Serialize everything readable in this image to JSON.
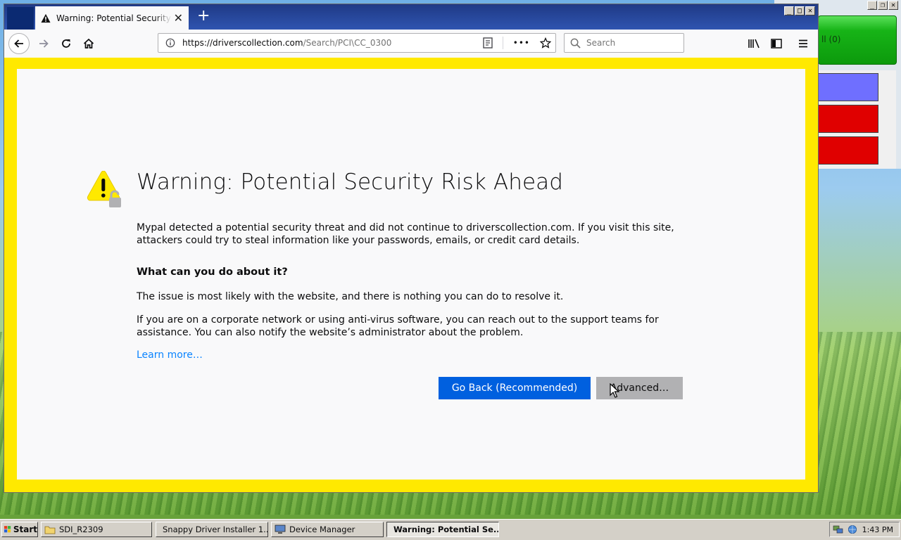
{
  "browser": {
    "tab_title": "Warning: Potential Security Risk Ahead",
    "new_tab_label": "+",
    "url_domain": "https://driverscollection.com",
    "url_path": "/Search/PCI\\CC_0300",
    "more_label": "•••",
    "search_placeholder": "Search",
    "minimize_label": "_",
    "maximize_label": "□",
    "close_label": "✕"
  },
  "page": {
    "title": "Warning: Potential Security Risk Ahead",
    "intro": "Mypal detected a potential security threat and did not continue to driverscollection.com. If you visit this site, attackers could try to steal information like your passwords, emails, or credit card details.",
    "what_heading": "What can you do about it?",
    "issue_text": "The issue is most likely with the website, and there is nothing you can do to resolve it.",
    "corporate_text": "If you are on a corporate network or using anti-virus software, you can reach out to the support teams for assistance. You can also notify the website’s administrator about the problem.",
    "learn_more": "Learn more…",
    "go_back_button": "Go Back (Recommended)",
    "advanced_button": "Advanced…"
  },
  "background_app": {
    "green_label": "ll (0)"
  },
  "taskbar": {
    "start_label": "Start",
    "tasks": [
      {
        "label": "SDI_R2309",
        "icon": "folder-icon"
      },
      {
        "label": "Snappy Driver Installer 1...",
        "icon": "sdi-icon"
      },
      {
        "label": "Device Manager",
        "icon": "device-manager-icon"
      },
      {
        "label": "Warning: Potential Se...",
        "icon": "warning-icon",
        "active": true
      }
    ],
    "clock": "1:43 PM"
  },
  "colors": {
    "warning_border": "#ffe900",
    "primary_button": "#0060df",
    "link": "#0a84ff",
    "tabstrip": "#2f54b0"
  }
}
